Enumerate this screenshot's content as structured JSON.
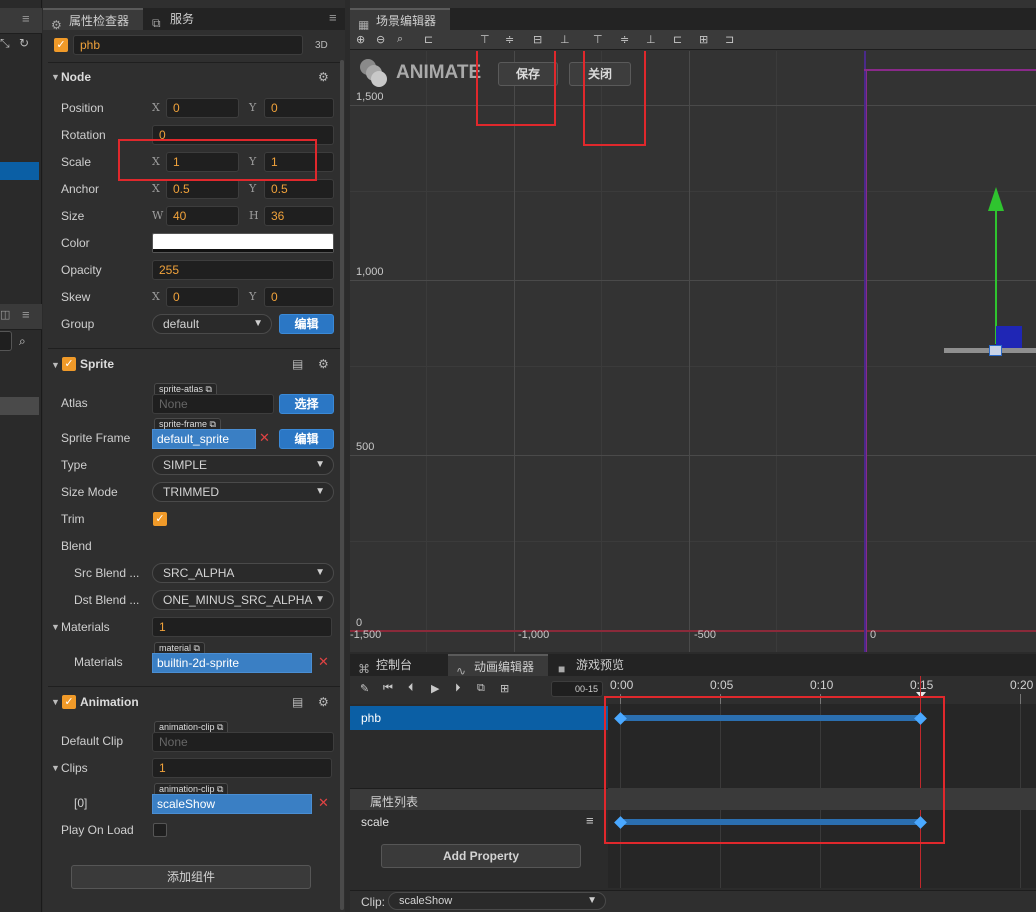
{
  "inspector": {
    "tab_inspector": "属性检查器",
    "tab_service": "服务",
    "node_name": "phb",
    "mode_3d": "3D",
    "node_section": "Node",
    "position_label": "Position",
    "position_x": "0",
    "position_y": "0",
    "rotation_label": "Rotation",
    "rotation_value": "0",
    "scale_label": "Scale",
    "scale_x": "1",
    "scale_y": "1",
    "anchor_label": "Anchor",
    "anchor_x": "0.5",
    "anchor_y": "0.5",
    "size_label": "Size",
    "size_w": "40",
    "size_h": "36",
    "color_label": "Color",
    "color_value": "#ffffff",
    "opacity_label": "Opacity",
    "opacity_value": "255",
    "skew_label": "Skew",
    "skew_x": "0",
    "skew_y": "0",
    "group_label": "Group",
    "group_value": "default",
    "edit_label": "编辑",
    "axis_x": "X",
    "axis_y": "Y",
    "axis_w": "W",
    "axis_h": "H",
    "sprite_section": "Sprite",
    "atlas_label": "Atlas",
    "atlas_tag": "sprite-atlas",
    "atlas_value": "None",
    "select_label": "选择",
    "sprite_frame_label": "Sprite Frame",
    "sprite_frame_tag": "sprite-frame",
    "sprite_frame_value": "default_sprite",
    "type_label": "Type",
    "type_value": "SIMPLE",
    "size_mode_label": "Size Mode",
    "size_mode_value": "TRIMMED",
    "trim_label": "Trim",
    "blend_label": "Blend",
    "src_blend_label": "Src Blend ...",
    "src_blend_value": "SRC_ALPHA",
    "dst_blend_label": "Dst Blend ...",
    "dst_blend_value": "ONE_MINUS_SRC_ALPHA",
    "materials_label": "Materials",
    "materials_count": "1",
    "material_tag": "material",
    "materials_item_label": "Materials",
    "materials_item_value": "builtin-2d-sprite",
    "animation_section": "Animation",
    "default_clip_label": "Default Clip",
    "animation_clip_tag": "animation-clip",
    "default_clip_value": "None",
    "clips_label": "Clips",
    "clips_count": "1",
    "clip0_label": "[0]",
    "clip0_value": "scaleShow",
    "play_on_load_label": "Play On Load",
    "add_component": "添加组件"
  },
  "scene": {
    "tab_label": "场景编辑器",
    "animate_title": "ANIMATE",
    "save_btn": "保存",
    "close_btn": "关闭",
    "y_labels": [
      "1,500",
      "1,000",
      "500",
      "0"
    ],
    "x_labels": [
      "-1,500",
      "-1,000",
      "-500",
      "0"
    ]
  },
  "timeline": {
    "tab_console": "控制台",
    "tab_anim": "动画编辑器",
    "tab_preview": "游戏预览",
    "frame_value": "00-15",
    "ruler": [
      "0:00",
      "0:05",
      "0:10",
      "0:15",
      "0:20"
    ],
    "node_row": "phb",
    "prop_list_title": "属性列表",
    "prop_row": "scale",
    "add_property": "Add Property",
    "clip_label": "Clip:",
    "clip_value": "scaleShow"
  },
  "colors": {
    "accent_orange": "#f09a29",
    "accent_blue": "#2b77c5",
    "red_highlight": "#e0282c",
    "key_blue": "#4aa8ff"
  }
}
